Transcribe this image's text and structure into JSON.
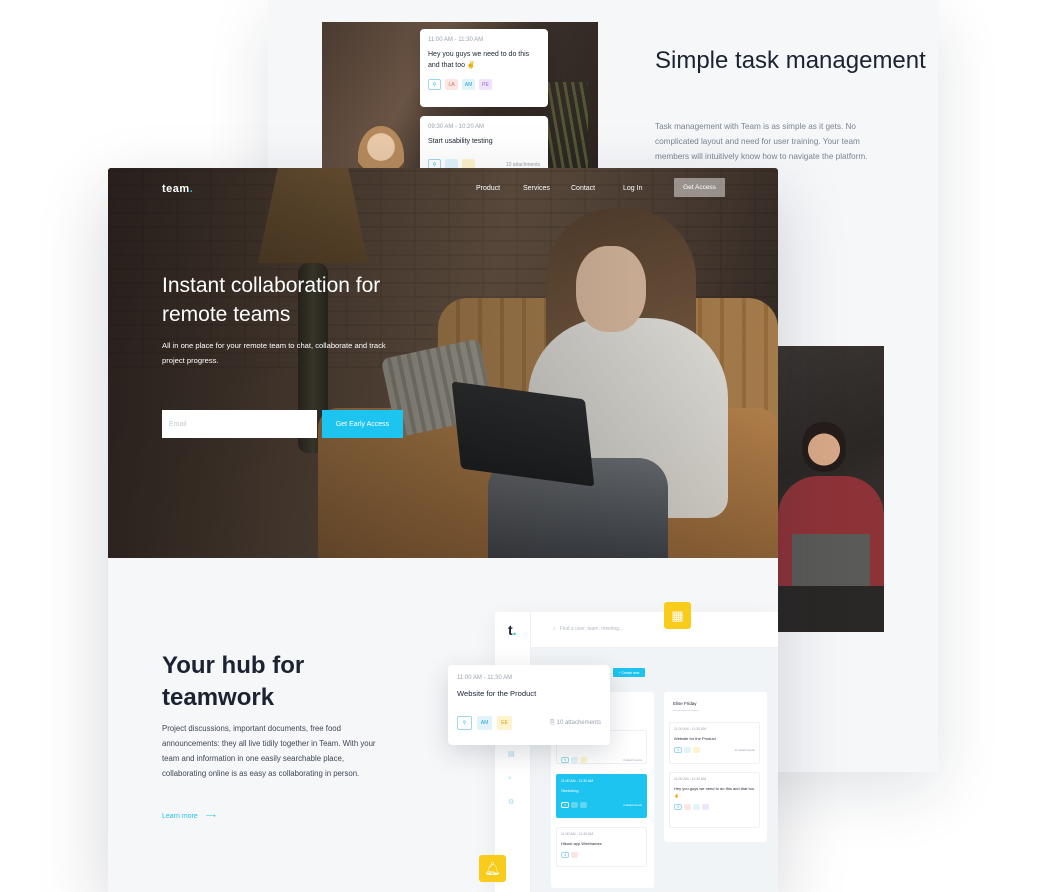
{
  "back": {
    "card1": {
      "time": "11:00 AM - 11:30 AM",
      "message": "Hey you guys we need to do this and that too ✌",
      "chips": [
        "LA",
        "AM",
        "PE"
      ]
    },
    "card2": {
      "time": "09:30 AM - 10:20 AM",
      "message": "Start usability testing",
      "attachments": "10 attachments"
    },
    "title": "Simple task management",
    "description": "Task management with Team is as simple as it gets. No complicated layout and need for user training. Your team members will intuitively know how to navigate the platform."
  },
  "nav": {
    "logo": "team",
    "logo_dot": ".",
    "links": [
      "Product",
      "Services",
      "Contact",
      "Log In"
    ],
    "cta": "Get Access"
  },
  "hero": {
    "title": "Instant collaboration for remote teams",
    "subtitle": "All in one place for your remote team to chat, collaborate and track project progress.",
    "email_placeholder": "Email",
    "button": "Get Early Access"
  },
  "hub": {
    "title": "Your hub for teamwork",
    "description": "Project discussions, important documents, free food announcements: they all live tidily together in Team. With your team and information in one easily searchable place, collaborating online is as easy as collaborating in person.",
    "learn_more": "Learn more"
  },
  "app": {
    "logo": "t",
    "logo_dot": ".",
    "search_placeholder": "Find a user, team, meeting...",
    "new_button": "+ Create new",
    "column2_title": "Elise Friday",
    "cards": [
      {
        "time": "11:00 AM - 11:30 AM",
        "message": "Sketching",
        "attachments": "3 attachments"
      },
      {
        "time": "11:00 AM - 11:30 AM",
        "message": "Hikout app Wireframes"
      },
      {
        "time": "11:00 AM - 11:30 AM",
        "message": "Website for the Product",
        "attachments": "10 attachments"
      },
      {
        "time": "11:00 AM - 11:30 AM",
        "message": "Hey you guys we need to do this and that too ✌"
      }
    ],
    "col1_partial_attachments": "3 attachments"
  },
  "float_card": {
    "time": "11:00 AM - 11:30 AM",
    "title": "Website for the Product",
    "chips": [
      "AM",
      "EE"
    ],
    "attachments": "10 attachements"
  },
  "colors": {
    "accent": "#1ec4f0",
    "badge": "#f9cc1b",
    "text": "#1b2332"
  }
}
